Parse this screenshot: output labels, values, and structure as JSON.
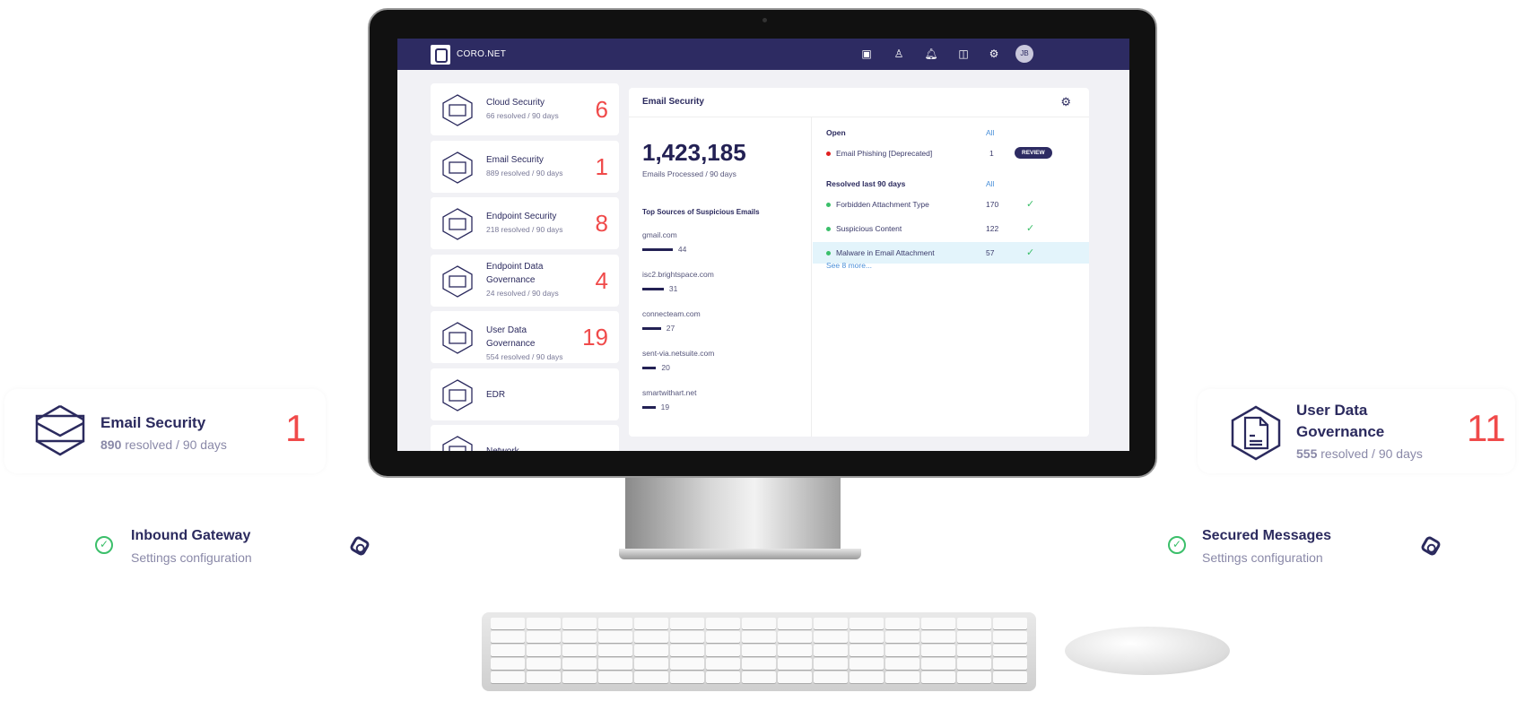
{
  "app": {
    "brand": "CORO.NET",
    "user_initials": "JB",
    "nav_icons": [
      "dashboard-icon",
      "user-icon",
      "bell-icon",
      "chart-icon",
      "gear-icon"
    ]
  },
  "modules": [
    {
      "name": "Cloud Security",
      "resolved": "66 resolved / 90 days",
      "count": "6",
      "icon": "cloud-icon"
    },
    {
      "name": "Email Security",
      "resolved": "889 resolved / 90 days",
      "count": "1",
      "icon": "envelope-icon"
    },
    {
      "name": "Endpoint Security",
      "resolved": "218 resolved / 90 days",
      "count": "8",
      "icon": "laptop-icon"
    },
    {
      "name": "Endpoint Data Governance",
      "resolved": "24 resolved / 90 days",
      "count": "4",
      "icon": "document-lines-icon"
    },
    {
      "name": "User Data Governance",
      "resolved": "554 resolved / 90 days",
      "count": "19",
      "icon": "file-icon"
    },
    {
      "name": "EDR",
      "resolved": "",
      "count": "",
      "icon": "edr-icon"
    },
    {
      "name": "Network",
      "resolved": "",
      "count": "",
      "icon": "network-icon"
    }
  ],
  "panel": {
    "title": "Email Security",
    "emails_processed": "1,423,185",
    "emails_processed_label": "Emails Processed / 90 days",
    "top_sources_title": "Top Sources of Suspicious Emails",
    "sources": [
      {
        "domain": "gmail.com",
        "count": 44
      },
      {
        "domain": "isc2.brightspace.com",
        "count": 31
      },
      {
        "domain": "connecteam.com",
        "count": 27
      },
      {
        "domain": "sent-via.netsuite.com",
        "count": 20
      },
      {
        "domain": "smartwithart.net",
        "count": 19
      }
    ],
    "open_label": "Open",
    "all_label": "All",
    "open_items": [
      {
        "name": "Email Phishing [Deprecated]",
        "count": "1",
        "action": "REVIEW"
      }
    ],
    "resolved_label": "Resolved last 90 days",
    "resolved_items": [
      {
        "name": "Forbidden Attachment Type",
        "count": "170"
      },
      {
        "name": "Suspicious Content",
        "count": "122"
      },
      {
        "name": "Malware in Email Attachment",
        "count": "57"
      }
    ],
    "see_more": "See 8 more..."
  },
  "callouts": {
    "left": {
      "title": "Email Security",
      "resolved_num": "890",
      "resolved_rest": " resolved / 90 days",
      "count": "1"
    },
    "right": {
      "title": "User Data Governance",
      "resolved_num": "555",
      "resolved_rest": " resolved / 90 days",
      "count": "11"
    },
    "inbound": {
      "title": "Inbound Gateway",
      "subtitle": "Settings configuration"
    },
    "secured": {
      "title": "Secured Messages",
      "subtitle": "Settings configuration"
    }
  },
  "colors": {
    "brand": "#2d2b62",
    "alert": "#f04a4a",
    "ok": "#3bbf6a",
    "link": "#4a90d9"
  }
}
